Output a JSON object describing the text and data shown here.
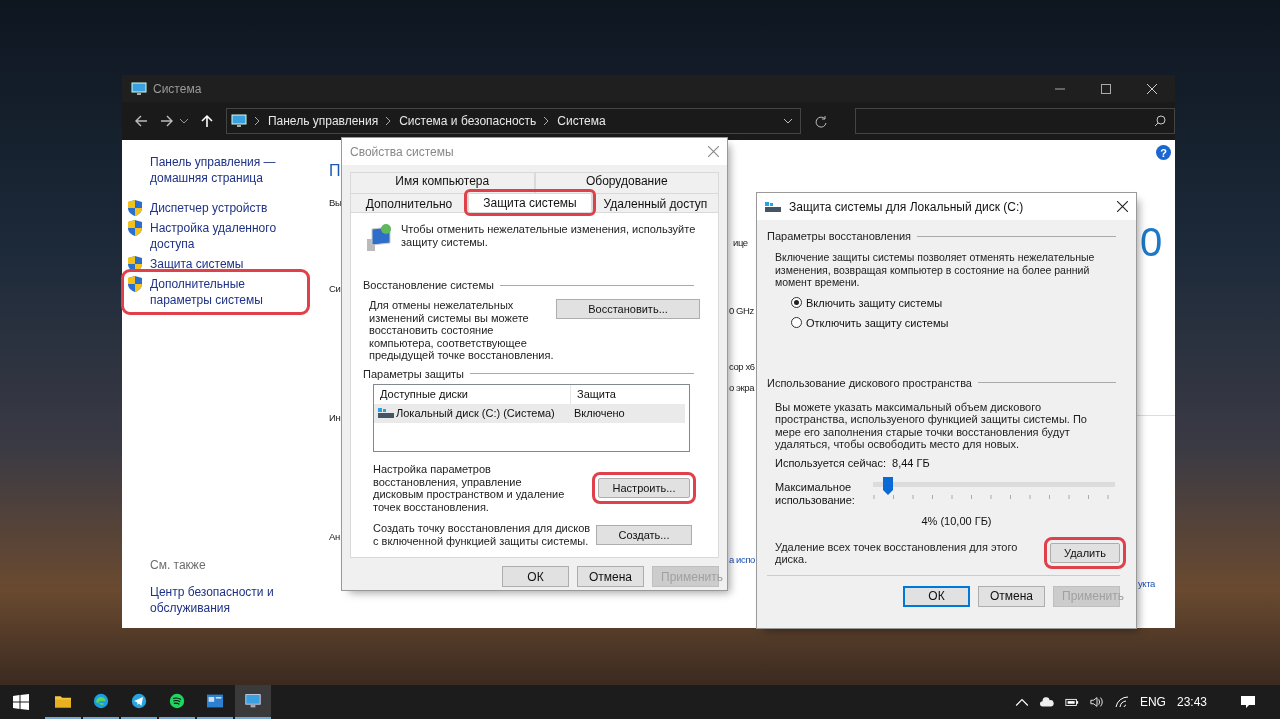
{
  "explorer": {
    "title": "Система",
    "breadcrumb": [
      "Панель управления",
      "Система и безопасность",
      "Система"
    ],
    "help_glyph": "?",
    "sidebar": {
      "home_link": "Панель управления — домашняя страница",
      "items": [
        {
          "label": "Диспетчер устройств",
          "highlighted": false
        },
        {
          "label": "Настройка удаленного доступа",
          "highlighted": false
        },
        {
          "label": "Защита системы",
          "highlighted": false
        },
        {
          "label": "Дополнительные параметры системы",
          "highlighted": true
        }
      ],
      "see_also_title": "См. также",
      "see_also_links": [
        "Центр безопасности и обслуживания"
      ]
    },
    "fragments": [
      {
        "text": "П",
        "kind": "heading"
      },
      {
        "text": "Вы",
        "kind": "text"
      },
      {
        "text": "Си",
        "kind": "text"
      },
      {
        "text": "Ин",
        "kind": "text"
      },
      {
        "text": "Ан",
        "kind": "text"
      },
      {
        "text": "ице",
        "kind": "text"
      },
      {
        "text": "0 GHz",
        "kind": "text"
      },
      {
        "text": "сор x6",
        "kind": "text"
      },
      {
        "text": "о экра",
        "kind": "text"
      },
      {
        "text": "а испо",
        "kind": "link"
      },
      {
        "text": "0",
        "kind": "big"
      },
      {
        "text": "укта",
        "kind": "link"
      }
    ]
  },
  "properties_dialog": {
    "title": "Свойства системы",
    "tab_rows": [
      [
        {
          "label": "Имя компьютера",
          "selected": false,
          "highlighted": false
        },
        {
          "label": "Оборудование",
          "selected": false,
          "highlighted": false
        }
      ],
      [
        {
          "label": "Дополнительно",
          "selected": false,
          "highlighted": false
        },
        {
          "label": "Защита системы",
          "selected": true,
          "highlighted": true
        },
        {
          "label": "Удаленный доступ",
          "selected": false,
          "highlighted": false
        }
      ]
    ],
    "intro": "Чтобы отменить нежелательные изменения, используйте защиту системы.",
    "restore_section": "Восстановление системы",
    "restore_text": "Для отмены нежелательных изменений системы вы можете восстановить состояние компьютера, соответствующее предыдущей точке восстановления.",
    "restore_button": "Восстановить...",
    "protection_section": "Параметры защиты",
    "table": {
      "columns": [
        "Доступные диски",
        "Защита"
      ],
      "rows": [
        {
          "disk": "Локальный диск (C:) (Система)",
          "protection": "Включено",
          "selected": true
        }
      ]
    },
    "configure_text": "Настройка параметров восстановления, управление дисковым пространством и удаление точек восстановления.",
    "configure_button": {
      "label": "Настроить...",
      "highlighted": true
    },
    "create_text": "Создать точку восстановления для дисков с включенной функцией защиты системы.",
    "create_button": "Создать...",
    "buttons": [
      {
        "label": "ОК",
        "disabled": false,
        "default": false
      },
      {
        "label": "Отмена",
        "disabled": false,
        "default": false
      },
      {
        "label": "Применить",
        "disabled": true,
        "default": false
      }
    ]
  },
  "disk_dialog": {
    "title": "Защита системы для Локальный диск (C:)",
    "restore_section": "Параметры восстановления",
    "restore_text": "Включение защиты системы позволяет отменять нежелательные изменения, возвращая компьютер в состояние на более ранний момент времени.",
    "radios": [
      {
        "label": "Включить защиту системы",
        "selected": true
      },
      {
        "label": "Отключить защиту системы",
        "selected": false
      }
    ],
    "usage_section": "Использование дискового пространства",
    "usage_text": "Вы можете указать максимальный объем дискового пространства, используеного функцией защиты системы. По мере его заполнения старые точки восстановления будут удаляться, чтобы освободить место для новых.",
    "used_label": "Используется сейчас:",
    "used_value": "8,44 ГБ",
    "slider": {
      "label": "Максимальное использование:",
      "level": 0.04,
      "reading": "4% (10,00 ГБ)"
    },
    "delete_text": "Удаление всех точек восстановления для этого диска.",
    "delete_button": {
      "label": "Удалить",
      "highlighted": true
    },
    "buttons": [
      {
        "label": "ОК",
        "disabled": false,
        "default": true
      },
      {
        "label": "Отмена",
        "disabled": false,
        "default": false
      },
      {
        "label": "Применить",
        "disabled": true,
        "default": false
      }
    ]
  },
  "taskbar": {
    "apps": [
      {
        "kind": "folder",
        "selected": false
      },
      {
        "kind": "browser",
        "selected": false
      },
      {
        "kind": "messenger",
        "selected": false
      },
      {
        "kind": "music",
        "selected": false
      },
      {
        "kind": "window-app",
        "selected": false
      },
      {
        "kind": "monitor",
        "selected": true
      }
    ],
    "language": "ENG",
    "time": "23:43"
  }
}
